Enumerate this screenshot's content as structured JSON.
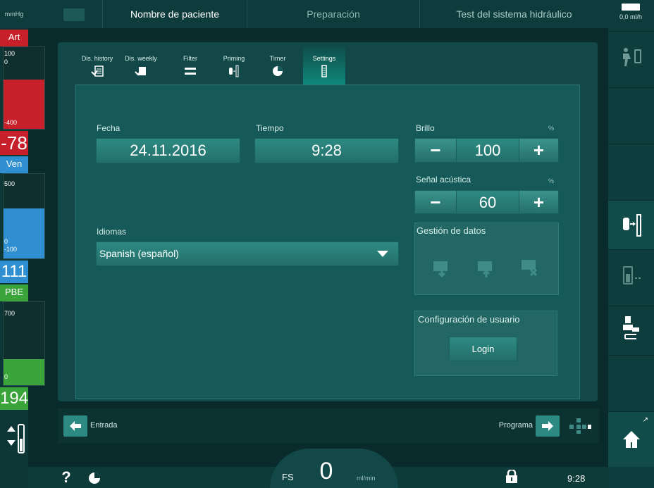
{
  "header": {
    "unit": "mmHg",
    "patient_tab": "Nombre de paciente",
    "phase_tab": "Preparación",
    "test_tab": "Test del sistema hidráulico",
    "rate_value": "0,0",
    "rate_unit": "ml/h"
  },
  "left": {
    "art": {
      "label": "Art",
      "upper": "100",
      "zero": "0",
      "lower": "-400",
      "value": "-78"
    },
    "ven": {
      "label": "Ven",
      "upper": "500",
      "zero": "0",
      "lower": "-100",
      "value": "111"
    },
    "pbe": {
      "label": "PBE",
      "upper": "700",
      "zero": "0",
      "value": "194"
    }
  },
  "tabs": [
    {
      "label": "Dis. history"
    },
    {
      "label": "Dis. weekly"
    },
    {
      "label": "Filter"
    },
    {
      "label": "Priming"
    },
    {
      "label": "Timer"
    },
    {
      "label": "Settings"
    }
  ],
  "settings": {
    "date_label": "Fecha",
    "date_value": "24.11.2016",
    "time_label": "Tiempo",
    "time_value": "9:28",
    "brightness_label": "Brillo",
    "brightness_unit": "%",
    "brightness_value": "100",
    "sound_label": "Señal acústica",
    "sound_unit": "%",
    "sound_value": "60",
    "language_label": "Idiomas",
    "language_value": "Spanish (español)",
    "data_mgmt_label": "Gestión de datos",
    "user_config_label": "Configuración de usuario",
    "login_label": "Login",
    "minus": "−",
    "plus": "+"
  },
  "nav": {
    "back_label": "Entrada",
    "next_label": "Programa"
  },
  "status": {
    "help": "?",
    "fs_label": "FS",
    "flow_value": "0",
    "flow_unit": "ml/min",
    "clock": "9:28"
  },
  "colors": {
    "art": "#c8202a",
    "ven": "#2f8fd0",
    "pbe": "#3aa43a",
    "accent": "#0f8a7c"
  }
}
